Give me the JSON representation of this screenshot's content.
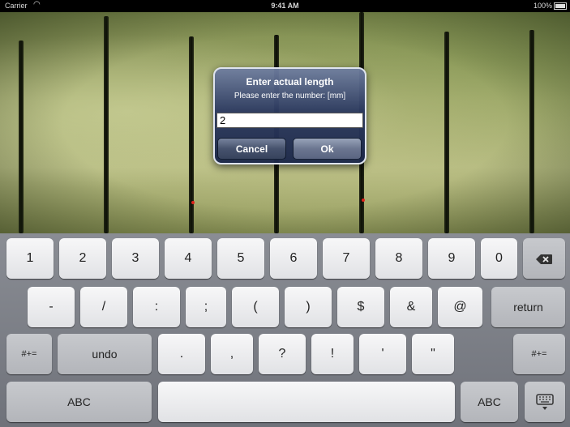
{
  "status_bar": {
    "carrier": "Carrier",
    "time": "9:41 AM",
    "battery": "100%",
    "wifi_icon": "wifi-icon",
    "battery_icon": "battery-icon"
  },
  "dialog": {
    "title": "Enter actual length",
    "message": "Please enter the number: [mm]",
    "input_value": "2",
    "cancel_label": "Cancel",
    "ok_label": "Ok"
  },
  "keyboard": {
    "row1": [
      "1",
      "2",
      "3",
      "4",
      "5",
      "6",
      "7",
      "8",
      "9",
      "0"
    ],
    "backspace_icon": "backspace-icon",
    "row2": [
      "-",
      "/",
      ":",
      ";",
      "(",
      ")",
      "$",
      "&",
      "@"
    ],
    "return_label": "return",
    "row3": {
      "shift_left": "#+=",
      "undo": "undo",
      "keys": [
        ".",
        ",",
        "?",
        "!",
        "'",
        "\""
      ],
      "shift_right": "#+="
    },
    "row4": {
      "abc_left": "ABC",
      "space": "",
      "abc_right": "ABC",
      "dismiss_icon": "keyboard-dismiss-icon"
    }
  },
  "colors": {
    "accent_marker": "#e0241b",
    "dialog_bg": "#2c3a60",
    "keyboard_bg": "#7c7f86"
  }
}
